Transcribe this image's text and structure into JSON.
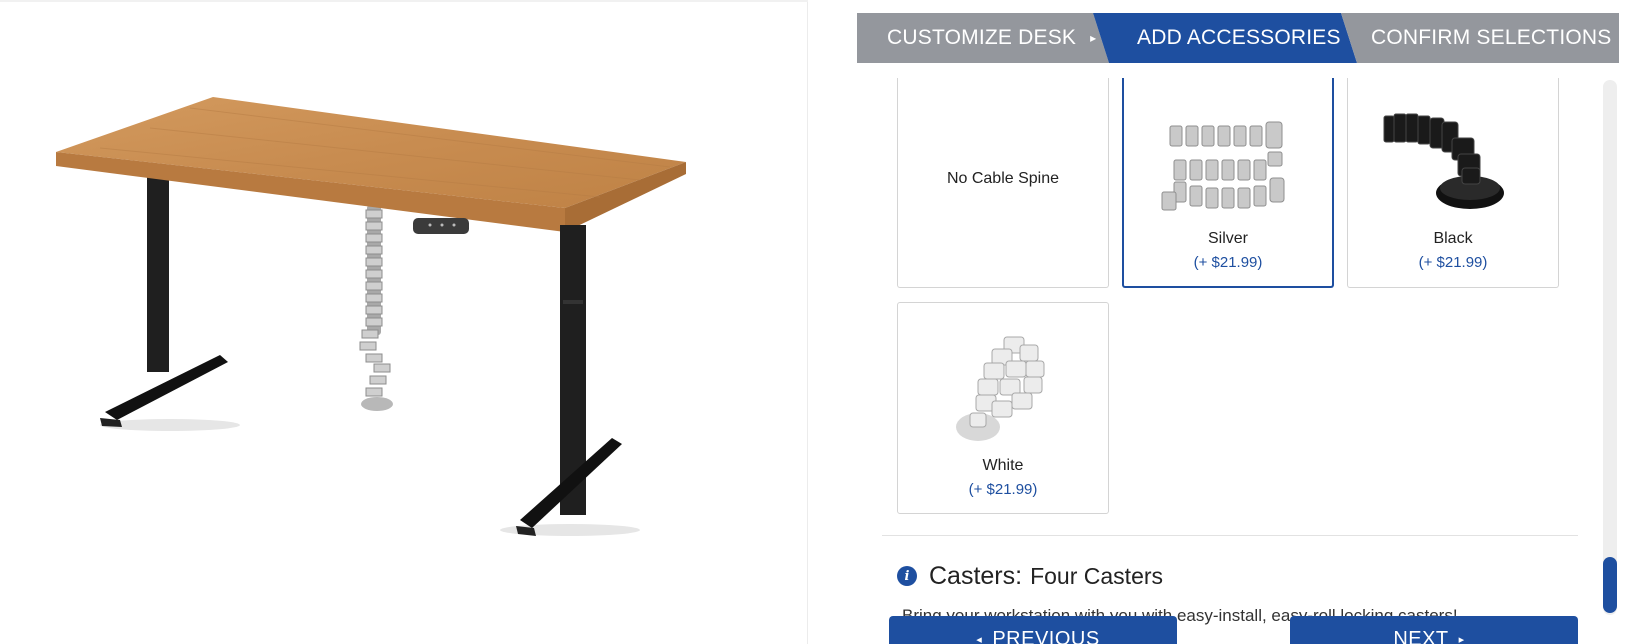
{
  "steps": [
    {
      "label": "CUSTOMIZE DESK",
      "caret": "▸",
      "active": false
    },
    {
      "label": "ADD ACCESSORIES",
      "caret": "▾",
      "active": true
    },
    {
      "label": "CONFIRM SELECTIONS",
      "caret": "▸",
      "active": false
    }
  ],
  "cable_spine": {
    "options": [
      {
        "name": "No Cable Spine",
        "price": "",
        "selected": false
      },
      {
        "name": "Silver",
        "price": "(+ $21.99)",
        "selected": true
      },
      {
        "name": "Black",
        "price": "(+ $21.99)",
        "selected": false
      },
      {
        "name": "White",
        "price": "(+ $21.99)",
        "selected": false
      }
    ]
  },
  "casters": {
    "title": "Casters:",
    "value": "Four Casters",
    "description": "Bring your workstation with you with easy-install, easy-roll locking casters!"
  },
  "buttons": {
    "previous": "PREVIOUS",
    "next": "NEXT",
    "prev_arrow": "◂",
    "next_arrow": "▸"
  },
  "colors": {
    "brand_blue": "#1e4fa0",
    "inactive_step": "#94979d",
    "desk_top": "#c98d52",
    "frame": "#1d1d1d"
  }
}
